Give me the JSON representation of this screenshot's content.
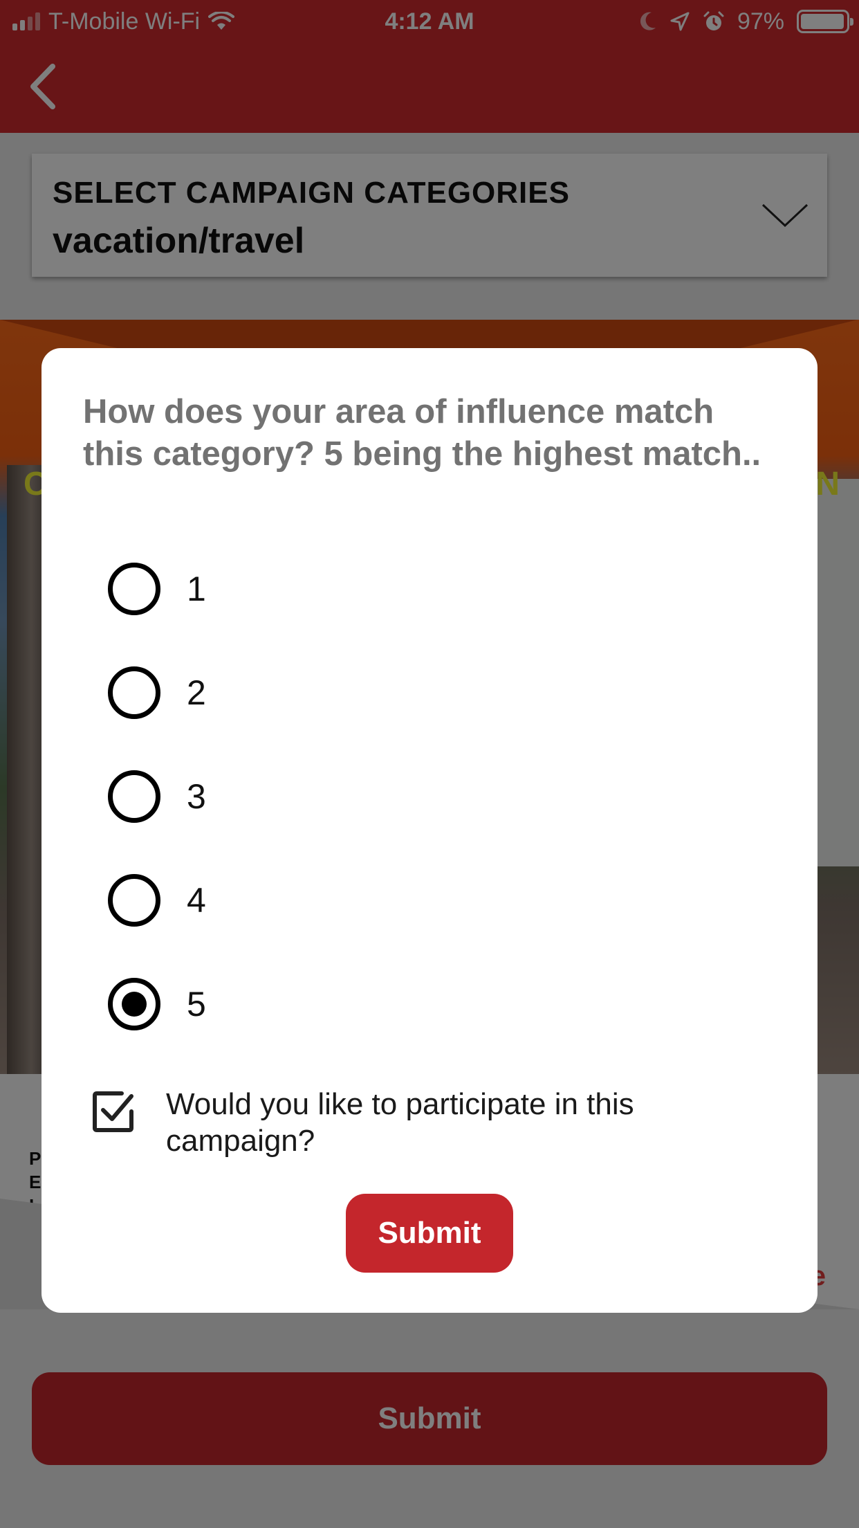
{
  "status_bar": {
    "carrier": "T-Mobile Wi-Fi",
    "time": "4:12 AM",
    "battery": "97%",
    "battery_level": 0.97
  },
  "navigation": {
    "back_icon": "chevron-left-icon"
  },
  "category_selector": {
    "label": "SELECT CAMPAIGN CATEGORIES",
    "value": "vacation/travel"
  },
  "background": {
    "banner_left_letter": "C",
    "banner_right_letter": "N",
    "side_text": "P\nE\nL",
    "side_text_right": "e",
    "submit_label": "Submit"
  },
  "modal": {
    "question": "How does your area of influence match this category? 5 being the highest match..",
    "options": [
      {
        "label": "1",
        "selected": false
      },
      {
        "label": "2",
        "selected": false
      },
      {
        "label": "3",
        "selected": false
      },
      {
        "label": "4",
        "selected": false
      },
      {
        "label": "5",
        "selected": true
      }
    ],
    "participate_label": "Would you like to participate in this campaign?",
    "participate_checked": true,
    "submit_label": "Submit"
  },
  "colors": {
    "brand_red": "#d12a2f",
    "button_red": "#c4262c",
    "question_gray": "#727272"
  }
}
